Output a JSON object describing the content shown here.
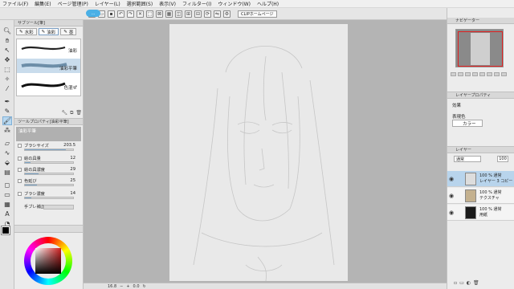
{
  "menu": [
    "ファイル(F)",
    "編集(E)",
    "ページ管理(P)",
    "レイヤー(L)",
    "選択範囲(S)",
    "表示(V)",
    "フィルター(I)",
    "ウィンドウ(W)",
    "ヘルプ(H)"
  ],
  "commandbar": {
    "badge": "...",
    "web_label": "CLIPホームページ",
    "icons": [
      "new",
      "open",
      "save",
      "undo",
      "redo",
      "clear",
      "transform",
      "deselect",
      "select-all",
      "invert",
      "expand",
      "reduce",
      "rotate",
      "flip"
    ]
  },
  "subtool": {
    "title": "サブツール[筆]",
    "tabs": [
      "水彩",
      "油彩",
      "墨"
    ],
    "brushes": [
      "油彩",
      "油彩平筆",
      "色混ぜ"
    ],
    "selected_index": 1
  },
  "toolprop": {
    "title": "ツールプロパティ[油彩平筆]",
    "tool_name": "油彩平筆",
    "rows": [
      {
        "name": "ブラシサイズ",
        "value": "203.5",
        "level": 0.85
      },
      {
        "name": "絵の具量",
        "value": "12",
        "level": 0.12
      },
      {
        "name": "絵の具濃度",
        "value": "29",
        "level": 0.29
      },
      {
        "name": "色延び",
        "value": "25",
        "level": 0.25
      },
      {
        "name": "ブラシ濃度",
        "value": "14",
        "level": 0.14
      },
      {
        "name": "手ブレ補正",
        "value": "",
        "level": 0.0
      }
    ]
  },
  "colors": {
    "main": "#000000",
    "sub": "#ffffff",
    "hue": "#d02020",
    "accent_select": "#b8d4ec"
  },
  "navigator": {
    "title": "ナビゲーター"
  },
  "layer_property": {
    "title": "レイヤープロパティ",
    "effect_label": "効果",
    "display_color_label": "表現色",
    "display_color_value": "カラー"
  },
  "layers": {
    "title": "レイヤー",
    "blend_mode": "通常",
    "opacity": "100",
    "rows": [
      {
        "line1": "100 %  通常",
        "line2": "レイヤー 3 コピー",
        "selected": true
      },
      {
        "line1": "100 %  通常",
        "line2": "テクスチャ",
        "selected": false
      },
      {
        "line1": "100 %  通常",
        "line2": "用紙",
        "selected": false
      }
    ]
  },
  "statusbar": {
    "zoom": "16.8",
    "angle": "0.0"
  }
}
